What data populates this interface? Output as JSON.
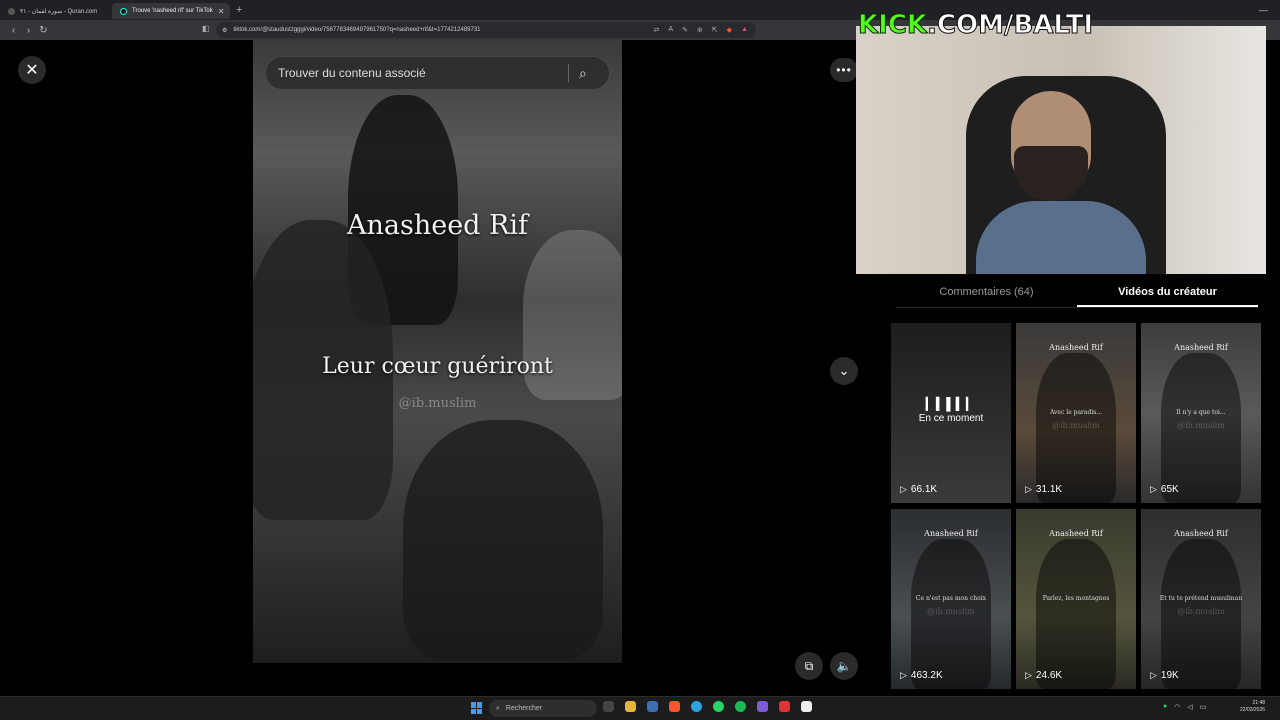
{
  "browser": {
    "tabs": [
      {
        "label": "سورة لقمان - ٣١ - Quran.com",
        "active": false
      },
      {
        "label": "Trouve 'nasheed rif' sur TikTok",
        "active": true
      }
    ],
    "url": "tiktok.com/@staudustzgggi/video/7587783469497961750?q=nasheed+rif&t=1774212489731"
  },
  "page": {
    "search": {
      "placeholder": "Trouver du contenu associé"
    },
    "video": {
      "title": "Anasheed Rif",
      "subtitle": "Leur cœur guériront",
      "handle": "@ib.muslim"
    }
  },
  "stream": {
    "overlay_green": "KICK",
    "overlay_white": ".COM/BALTI",
    "green_color": "#53fc18"
  },
  "panel": {
    "tabs": {
      "comments": "Commentaires (64)",
      "videos": "Vidéos du créateur"
    },
    "videos": [
      {
        "now_playing": true,
        "now_label": "En ce moment",
        "title": "",
        "caption": "",
        "watermark": "",
        "views": "66.1K"
      },
      {
        "now_playing": false,
        "now_label": "",
        "title": "Anasheed Rif",
        "caption": "Avec le paradis...",
        "watermark": "@ib.muslim",
        "views": "31.1K"
      },
      {
        "now_playing": false,
        "now_label": "",
        "title": "Anasheed Rif",
        "caption": "Il n'y a que toi...",
        "watermark": "@ib.muslim",
        "views": "65K"
      },
      {
        "now_playing": false,
        "now_label": "",
        "title": "Anasheed Rif",
        "caption": "Ce n'est pas mon choix",
        "watermark": "@ib.muslim",
        "views": "463.2K"
      },
      {
        "now_playing": false,
        "now_label": "",
        "title": "Anasheed Rif",
        "caption": "Parlez, les montagnes",
        "watermark": "",
        "views": "24.6K"
      },
      {
        "now_playing": false,
        "now_label": "",
        "title": "Anasheed Rif",
        "caption": "Et tu te prétend musulman",
        "watermark": "@ib.muslim",
        "views": "19K"
      }
    ]
  },
  "taskbar": {
    "search_placeholder": "Rechercher",
    "time": "21:48",
    "date": "22/03/2026"
  }
}
